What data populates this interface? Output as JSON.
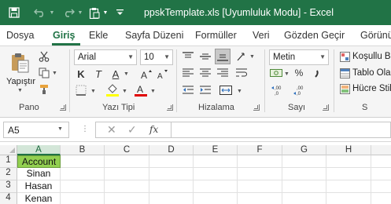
{
  "window": {
    "title": "ppskTemplate.xls  [Uyumluluk Modu]  -  Excel",
    "accent": "#217346"
  },
  "quick_access": {
    "icons": [
      "save-icon",
      "undo-icon",
      "redo-icon",
      "clipboard-icon",
      "customize-icon"
    ]
  },
  "tabs": [
    "Dosya",
    "Giriş",
    "Ekle",
    "Sayfa Düzeni",
    "Formüller",
    "Veri",
    "Gözden Geçir",
    "Görünüm"
  ],
  "active_tab": "Giriş",
  "ribbon": {
    "groups": {
      "clipboard": "Pano",
      "font": "Yazı Tipi",
      "alignment": "Hizalama",
      "number": "Sayı",
      "styles": "S"
    },
    "paste_label": "Yapıştır",
    "font_name": "Arial",
    "font_size": "10",
    "number_format": "Metin",
    "styles_buttons": [
      "Koşullu Bi",
      "Tablo Olar",
      "Hücre Stil"
    ],
    "font_buttons": [
      "K",
      "T",
      "A"
    ]
  },
  "formula_bar": {
    "name_box": "A5",
    "formula": ""
  },
  "sheet": {
    "columns": [
      "A",
      "B",
      "C",
      "D",
      "E",
      "F",
      "G",
      "H"
    ],
    "selected_column": "A",
    "rows": [
      {
        "num": "1",
        "a": "Account"
      },
      {
        "num": "2",
        "a": "Sinan"
      },
      {
        "num": "3",
        "a": "Hasan"
      },
      {
        "num": "4",
        "a": "Kenan"
      }
    ],
    "header_fill": "#92d050"
  }
}
